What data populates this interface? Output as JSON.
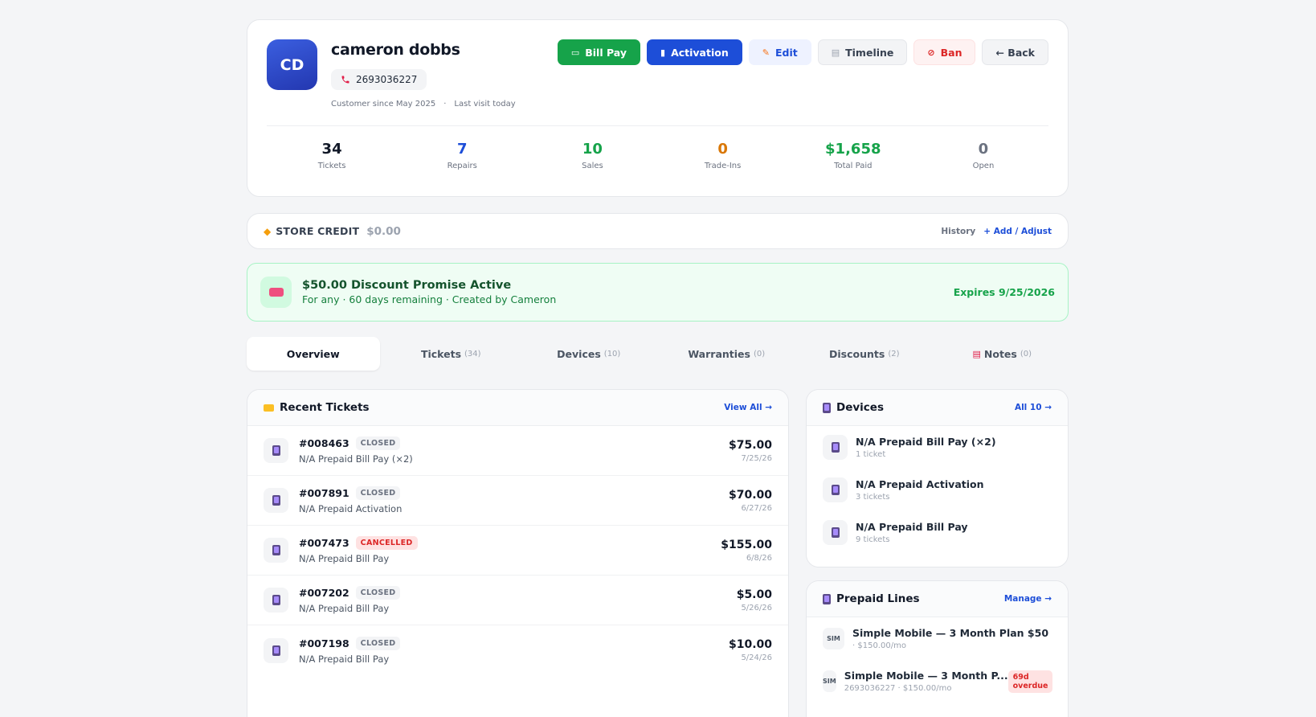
{
  "customer": {
    "initials": "CD",
    "name": "cameron dobbs",
    "phone": "2693036227",
    "since": "Customer since May 2025",
    "separator": "·",
    "last_visit": "Last visit today"
  },
  "actions": {
    "bill_pay": "Bill Pay",
    "activation": "Activation",
    "edit": "Edit",
    "timeline": "Timeline",
    "ban": "Ban",
    "back": "← Back"
  },
  "stats": [
    {
      "value": "34",
      "label": "Tickets",
      "color": "#111827"
    },
    {
      "value": "7",
      "label": "Repairs",
      "color": "#1d4ed8"
    },
    {
      "value": "10",
      "label": "Sales",
      "color": "#16a34a"
    },
    {
      "value": "0",
      "label": "Trade-Ins",
      "color": "#d97706"
    },
    {
      "value": "$1,658",
      "label": "Total Paid",
      "color": "#16a34a"
    },
    {
      "value": "0",
      "label": "Open",
      "color": "#6b7280"
    }
  ],
  "store_credit": {
    "label": "STORE CREDIT",
    "amount": "$0.00",
    "history": "History",
    "add_adjust": "+ Add / Adjust"
  },
  "promo": {
    "title": "$50.00 Discount Promise Active",
    "subtitle": "For any · 60 days remaining · Created by Cameron",
    "expires": "Expires 9/25/2026"
  },
  "tabs": [
    {
      "label": "Overview",
      "count": ""
    },
    {
      "label": "Tickets",
      "count": "(34)"
    },
    {
      "label": "Devices",
      "count": "(10)"
    },
    {
      "label": "Warranties",
      "count": "(0)"
    },
    {
      "label": "Discounts",
      "count": "(2)"
    },
    {
      "label": "Notes",
      "count": "(0)"
    }
  ],
  "recent_tickets": {
    "title": "Recent Tickets",
    "view_all": "View All →",
    "rows": [
      {
        "number": "#008463",
        "status": "CLOSED",
        "desc": "N/A Prepaid Bill Pay (×2)",
        "amount": "$75.00",
        "date": "7/25/26"
      },
      {
        "number": "#007891",
        "status": "CLOSED",
        "desc": "N/A Prepaid Activation",
        "amount": "$70.00",
        "date": "6/27/26"
      },
      {
        "number": "#007473",
        "status": "CANCELLED",
        "desc": "N/A Prepaid Bill Pay",
        "amount": "$155.00",
        "date": "6/8/26"
      },
      {
        "number": "#007202",
        "status": "CLOSED",
        "desc": "N/A Prepaid Bill Pay",
        "amount": "$5.00",
        "date": "5/26/26"
      },
      {
        "number": "#007198",
        "status": "CLOSED",
        "desc": "N/A Prepaid Bill Pay",
        "amount": "$10.00",
        "date": "5/24/26"
      }
    ]
  },
  "devices": {
    "title": "Devices",
    "all_link": "All 10 →",
    "rows": [
      {
        "name": "N/A Prepaid Bill Pay (×2)",
        "sub": "1 ticket"
      },
      {
        "name": "N/A Prepaid Activation",
        "sub": "3 tickets"
      },
      {
        "name": "N/A Prepaid Bill Pay",
        "sub": "9 tickets"
      }
    ]
  },
  "prepaid_lines": {
    "title": "Prepaid Lines",
    "manage": "Manage →",
    "rows": [
      {
        "sim": "SIM",
        "name": "Simple Mobile — 3 Month Plan $50",
        "sub": "· $150.00/mo",
        "badge": ""
      },
      {
        "sim": "SIM",
        "name": "Simple Mobile — 3 Month P...",
        "sub": "2693036227 · $150.00/mo",
        "badge": "69d overdue"
      }
    ]
  }
}
